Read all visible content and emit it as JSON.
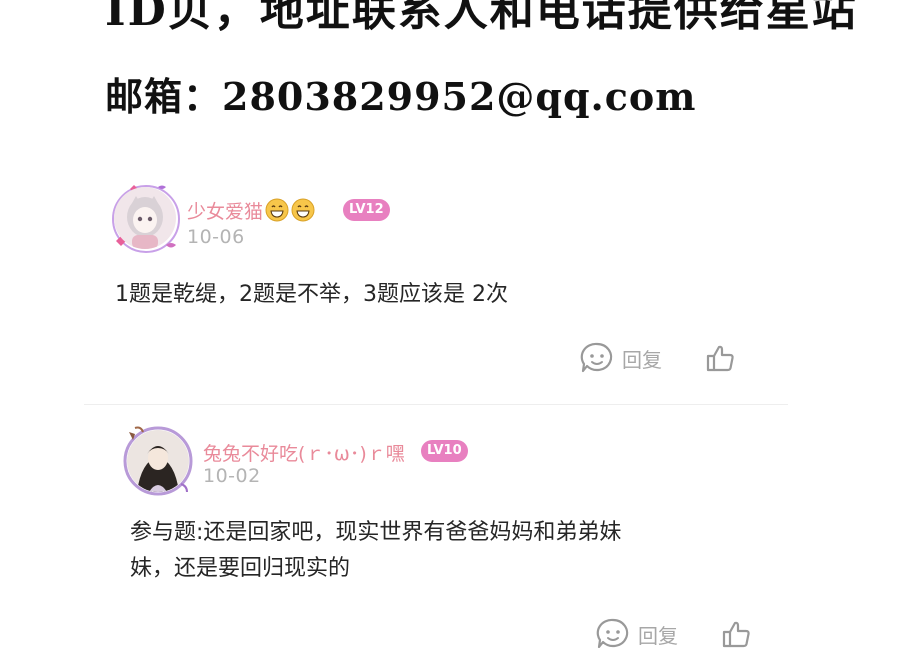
{
  "header": {
    "line1": "ID贝，地址联系人和电话提供给星站",
    "line2": "邮箱：2803829952@qq.com"
  },
  "comments": [
    {
      "username": "少女爱猫",
      "emoji": [
        "grin-emoji",
        "grin-emoji"
      ],
      "level": "LV12",
      "date": "10-06",
      "text": "1题是乾缇，2题是不举，3题应该是 2次",
      "reply_label": "回复"
    },
    {
      "username": "兔兔不好吃(ｒ･ω･)ｒ嘿",
      "level": "LV10",
      "date": "10-02",
      "text_lines": [
        "参与题:还是回家吧，现实世界有爸爸妈妈和弟弟妹",
        "妹，还是要回归现实的"
      ],
      "reply_label": "回复"
    }
  ],
  "colors": {
    "username": "#e98a9a",
    "level_badge": "#e880c0",
    "date": "#b4b4b4",
    "icon": "#999999"
  }
}
